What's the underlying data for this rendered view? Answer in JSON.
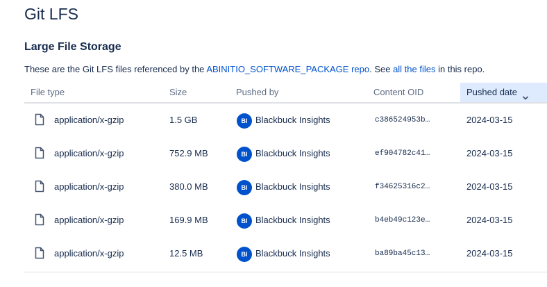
{
  "page": {
    "title": "Git LFS"
  },
  "section": {
    "title": "Large File Storage",
    "desc_prefix": "These are the Git LFS files referenced by the ",
    "repo_link": "ABINITIO_SOFTWARE_PACKAGE repo",
    "desc_middle": ". See ",
    "all_files_link": "all the files",
    "desc_suffix": " in this repo."
  },
  "table": {
    "headers": {
      "file_type": "File type",
      "size": "Size",
      "pushed_by": "Pushed by",
      "content_oid": "Content OID",
      "pushed_date": "Pushed date"
    },
    "sort_icon": "chevron-down-icon",
    "rows": [
      {
        "file_type": "application/x-gzip",
        "size": "1.5 GB",
        "avatar": "BI",
        "pushed_by": "Blackbuck Insights",
        "oid": "c386524953b…",
        "date": "2024-03-15"
      },
      {
        "file_type": "application/x-gzip",
        "size": "752.9 MB",
        "avatar": "BI",
        "pushed_by": "Blackbuck Insights",
        "oid": "ef904782c41…",
        "date": "2024-03-15"
      },
      {
        "file_type": "application/x-gzip",
        "size": "380.0 MB",
        "avatar": "BI",
        "pushed_by": "Blackbuck Insights",
        "oid": "f34625316c2…",
        "date": "2024-03-15"
      },
      {
        "file_type": "application/x-gzip",
        "size": "169.9 MB",
        "avatar": "BI",
        "pushed_by": "Blackbuck Insights",
        "oid": "b4eb49c123e…",
        "date": "2024-03-15"
      },
      {
        "file_type": "application/x-gzip",
        "size": "12.5 MB",
        "avatar": "BI",
        "pushed_by": "Blackbuck Insights",
        "oid": "ba89ba45c13…",
        "date": "2024-03-15"
      }
    ]
  },
  "colors": {
    "link": "#0052cc",
    "avatar_bg": "#0052cc",
    "sorted_header_bg": "#deebff",
    "text": "#172b4d",
    "muted": "#5e6c84"
  }
}
